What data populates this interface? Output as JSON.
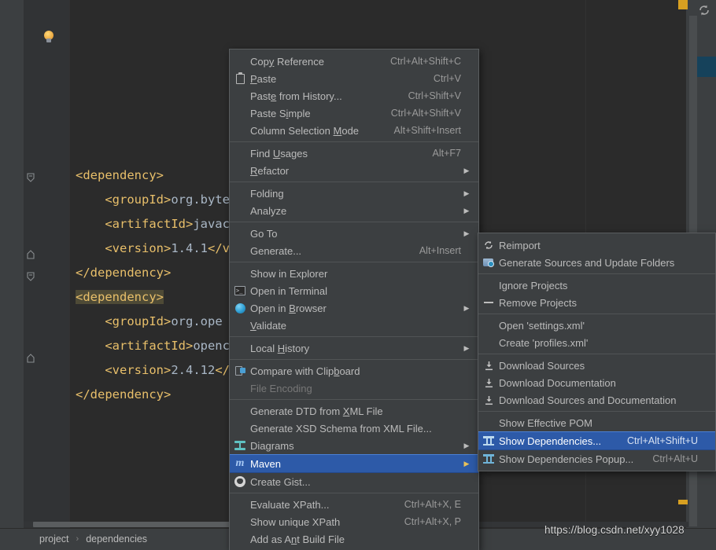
{
  "editor": {
    "breadcrumb": {
      "items": [
        "project",
        "dependencies"
      ],
      "separator": "›"
    },
    "watermark": "https://blog.csdn.net/xyy1028",
    "code_lines": [
      {
        "indent": 0,
        "parts": [
          {
            "t": "tag",
            "s": "<dependency>"
          }
        ]
      },
      {
        "indent": 1,
        "parts": [
          {
            "t": "tag",
            "s": "<groupId>"
          },
          {
            "t": "val",
            "s": "org.byte"
          }
        ]
      },
      {
        "indent": 1,
        "parts": [
          {
            "t": "tag",
            "s": "<artifactId>"
          },
          {
            "t": "val",
            "s": "javacv-"
          }
        ]
      },
      {
        "indent": 1,
        "parts": [
          {
            "t": "tag",
            "s": "<version>"
          },
          {
            "t": "val",
            "s": "1.4.1"
          },
          {
            "t": "tag",
            "s": "</ve"
          }
        ]
      },
      {
        "indent": 0,
        "parts": [
          {
            "t": "tag",
            "s": "</dependency>"
          }
        ]
      },
      {
        "indent": 0,
        "parts": [
          {
            "t": "sel-tag",
            "s": "<dependency>"
          }
        ]
      },
      {
        "indent": 1,
        "parts": [
          {
            "t": "tag",
            "s": "<groupId>"
          },
          {
            "t": "val",
            "s": "org.ope"
          }
        ]
      },
      {
        "indent": 1,
        "parts": [
          {
            "t": "tag",
            "s": "<artifactId>"
          },
          {
            "t": "val",
            "s": "opencv"
          }
        ]
      },
      {
        "indent": 1,
        "parts": [
          {
            "t": "tag",
            "s": "<version>"
          },
          {
            "t": "val",
            "s": "2.4.12"
          },
          {
            "t": "tag",
            "s": "</v"
          }
        ]
      },
      {
        "indent": 0,
        "parts": [
          {
            "t": "tag",
            "s": "</dependency>"
          }
        ]
      }
    ],
    "icons": {
      "intention_bulb": "lightbulb-icon",
      "sync": "sync-refresh-icon"
    }
  },
  "context_menu": {
    "groups": [
      {
        "items": [
          {
            "label": "Copy Reference",
            "accel": "Ctrl+Alt+Shift+C",
            "icon": "",
            "arrow": false,
            "mnemonic": "y"
          },
          {
            "label": "Paste",
            "accel": "Ctrl+V",
            "icon": "clipboard-icon",
            "arrow": false,
            "mnemonic": "P"
          },
          {
            "label": "Paste from History...",
            "accel": "Ctrl+Shift+V",
            "icon": "",
            "arrow": false,
            "mnemonic": "e"
          },
          {
            "label": "Paste Simple",
            "accel": "Ctrl+Alt+Shift+V",
            "icon": "",
            "arrow": false,
            "mnemonic": "i"
          },
          {
            "label": "Column Selection Mode",
            "accel": "Alt+Shift+Insert",
            "icon": "",
            "arrow": false,
            "mnemonic": "M"
          }
        ]
      },
      {
        "items": [
          {
            "label": "Find Usages",
            "accel": "Alt+F7",
            "icon": "",
            "arrow": false,
            "mnemonic": "U"
          },
          {
            "label": "Refactor",
            "accel": "",
            "icon": "",
            "arrow": true,
            "mnemonic": "R"
          }
        ]
      },
      {
        "items": [
          {
            "label": "Folding",
            "accel": "",
            "icon": "",
            "arrow": true
          },
          {
            "label": "Analyze",
            "accel": "",
            "icon": "",
            "arrow": true
          }
        ]
      },
      {
        "items": [
          {
            "label": "Go To",
            "accel": "",
            "icon": "",
            "arrow": true
          },
          {
            "label": "Generate...",
            "accel": "Alt+Insert",
            "icon": "",
            "arrow": false
          }
        ]
      },
      {
        "items": [
          {
            "label": "Show in Explorer",
            "accel": "",
            "icon": "",
            "arrow": false
          },
          {
            "label": "Open in Terminal",
            "accel": "",
            "icon": "terminal-icon",
            "arrow": false
          },
          {
            "label": "Open in Browser",
            "accel": "",
            "icon": "globe-icon",
            "arrow": true,
            "mnemonic": "B"
          },
          {
            "label": "Validate",
            "accel": "",
            "icon": "",
            "arrow": false,
            "mnemonic": "V"
          }
        ]
      },
      {
        "items": [
          {
            "label": "Local History",
            "accel": "",
            "icon": "",
            "arrow": true,
            "mnemonic": "H"
          }
        ]
      },
      {
        "items": [
          {
            "label": "Compare with Clipboard",
            "accel": "",
            "icon": "compare-icon",
            "arrow": false,
            "mnemonic": "b"
          },
          {
            "label": "File Encoding",
            "accel": "",
            "icon": "",
            "arrow": false,
            "disabled": true
          }
        ]
      },
      {
        "items": [
          {
            "label": "Generate DTD from XML File",
            "accel": "",
            "icon": "",
            "arrow": false,
            "mnemonic": "X"
          },
          {
            "label": "Generate XSD Schema from XML File...",
            "accel": "",
            "icon": "",
            "arrow": false
          },
          {
            "label": "Diagrams",
            "accel": "",
            "icon": "diagram-icon",
            "arrow": true
          },
          {
            "label": "Maven",
            "accel": "",
            "icon": "maven-icon",
            "arrow": true,
            "selected": true
          },
          {
            "label": "Create Gist...",
            "accel": "",
            "icon": "github-icon",
            "arrow": false
          }
        ]
      },
      {
        "items": [
          {
            "label": "Evaluate XPath...",
            "accel": "Ctrl+Alt+X, E",
            "icon": "",
            "arrow": false
          },
          {
            "label": "Show unique XPath",
            "accel": "Ctrl+Alt+X, P",
            "icon": "",
            "arrow": false
          },
          {
            "label": "Add as Ant Build File",
            "accel": "",
            "icon": "",
            "arrow": false,
            "mnemonic": "n"
          }
        ]
      }
    ]
  },
  "maven_submenu": {
    "groups": [
      {
        "items": [
          {
            "label": "Reimport",
            "accel": "",
            "icon": "reimport-icon",
            "arrow": false
          },
          {
            "label": "Generate Sources and Update Folders",
            "accel": "",
            "icon": "folder-update-icon",
            "arrow": false
          }
        ]
      },
      {
        "items": [
          {
            "label": "Ignore Projects",
            "accel": "",
            "icon": "",
            "arrow": false
          },
          {
            "label": "Remove Projects",
            "accel": "",
            "icon": "minus-icon",
            "arrow": false
          }
        ]
      },
      {
        "items": [
          {
            "label": "Open 'settings.xml'",
            "accel": "",
            "icon": "",
            "arrow": false
          },
          {
            "label": "Create 'profiles.xml'",
            "accel": "",
            "icon": "",
            "arrow": false
          }
        ]
      },
      {
        "items": [
          {
            "label": "Download Sources",
            "accel": "",
            "icon": "download-icon",
            "arrow": false
          },
          {
            "label": "Download Documentation",
            "accel": "",
            "icon": "download-icon",
            "arrow": false
          },
          {
            "label": "Download Sources and Documentation",
            "accel": "",
            "icon": "download-icon",
            "arrow": false
          }
        ]
      },
      {
        "items": [
          {
            "label": "Show Effective POM",
            "accel": "",
            "icon": "",
            "arrow": false
          },
          {
            "label": "Show Dependencies...",
            "accel": "Ctrl+Alt+Shift+U",
            "icon": "dependencies-icon",
            "arrow": false,
            "selected": true
          },
          {
            "label": "Show Dependencies Popup...",
            "accel": "Ctrl+Alt+U",
            "icon": "dependencies-icon",
            "arrow": false
          }
        ]
      }
    ]
  },
  "colors": {
    "editor_bg": "#2b2b2b",
    "menu_bg": "#3c3f41",
    "gutter_bg": "#313335",
    "selection_blue": "#2d5aa8",
    "xml_tag": "#e8bf6a",
    "xml_text": "#a9b7c6",
    "code_selection": "#4e4a36",
    "marker_orange": "#d8a021"
  }
}
